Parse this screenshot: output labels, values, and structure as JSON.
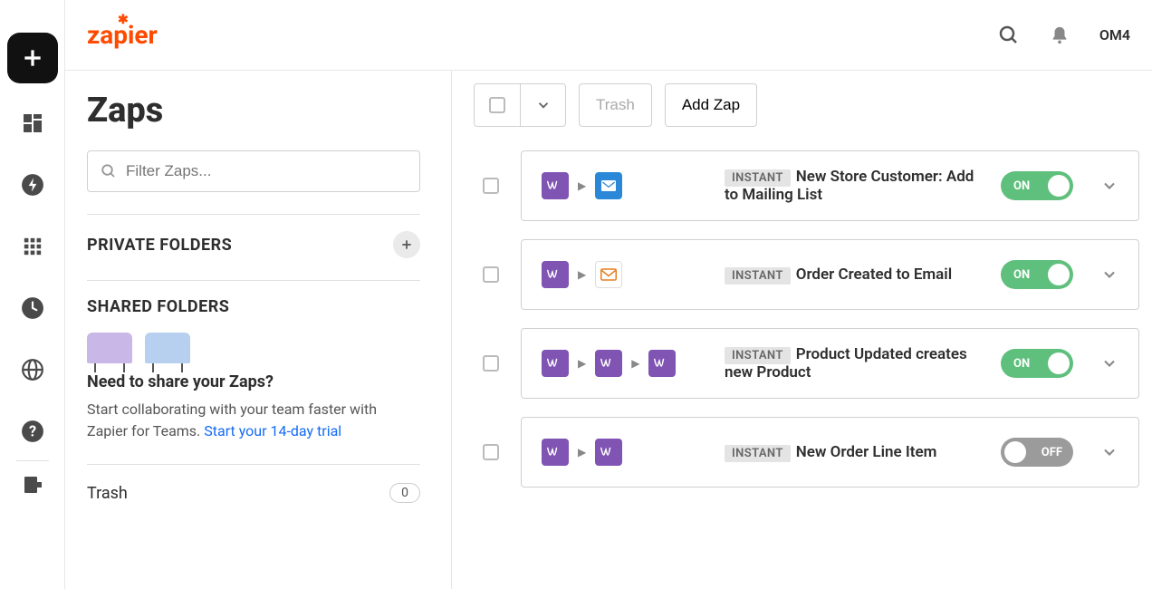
{
  "header": {
    "logo": "zapier",
    "user_badge": "OM4"
  },
  "page": {
    "title": "Zaps",
    "filter_placeholder": "Filter Zaps..."
  },
  "sidebar": {
    "private_folders_title": "PRIVATE FOLDERS",
    "shared_folders_title": "SHARED FOLDERS",
    "shared_heading": "Need to share your Zaps?",
    "shared_body": "Start collaborating with your team faster with Zapier for Teams. ",
    "shared_link": "Start your 14-day trial",
    "trash_label": "Trash",
    "trash_count": "0"
  },
  "toolbar": {
    "trash_label": "Trash",
    "add_zap_label": "Add Zap"
  },
  "badges": {
    "instant": "INSTANT"
  },
  "toggles": {
    "on": "ON",
    "off": "OFF"
  },
  "zaps": [
    {
      "name": "New Store Customer: Add to Mailing List",
      "instant": true,
      "on": true,
      "apps": [
        "woo",
        "blue"
      ]
    },
    {
      "name": "Order Created to Email",
      "instant": true,
      "on": true,
      "apps": [
        "woo",
        "mail"
      ]
    },
    {
      "name": "Product Updated creates new Product",
      "instant": true,
      "on": true,
      "apps": [
        "woo",
        "woo",
        "woo"
      ]
    },
    {
      "name": "New Order Line Item",
      "instant": true,
      "on": false,
      "apps": [
        "woo",
        "woo"
      ]
    }
  ]
}
